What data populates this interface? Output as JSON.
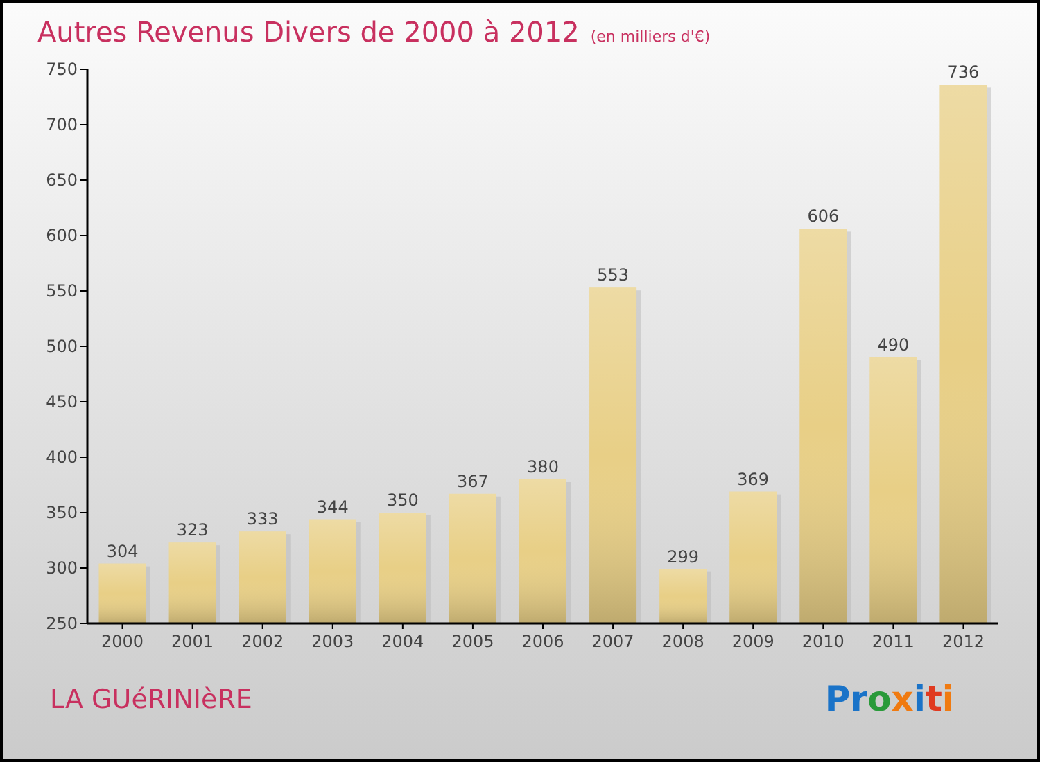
{
  "subtitle": "(en milliers d'€)",
  "chart_data": {
    "type": "bar",
    "title": "Autres Revenus Divers de 2000 à 2012",
    "categories": [
      "2000",
      "2001",
      "2002",
      "2003",
      "2004",
      "2005",
      "2006",
      "2007",
      "2008",
      "2009",
      "2010",
      "2011",
      "2012"
    ],
    "series": [
      {
        "color": "#e8cf86",
        "values": [
          304,
          323,
          333,
          344,
          350,
          367,
          380,
          553,
          299,
          369,
          606,
          490,
          736
        ]
      }
    ],
    "ylim": [
      250,
      750
    ],
    "yticks": [
      250,
      300,
      350,
      400,
      450,
      500,
      550,
      600,
      650,
      700,
      750
    ],
    "data_labels": true
  },
  "place": "LA GUéRINIèRE",
  "logo": "Proxiti"
}
